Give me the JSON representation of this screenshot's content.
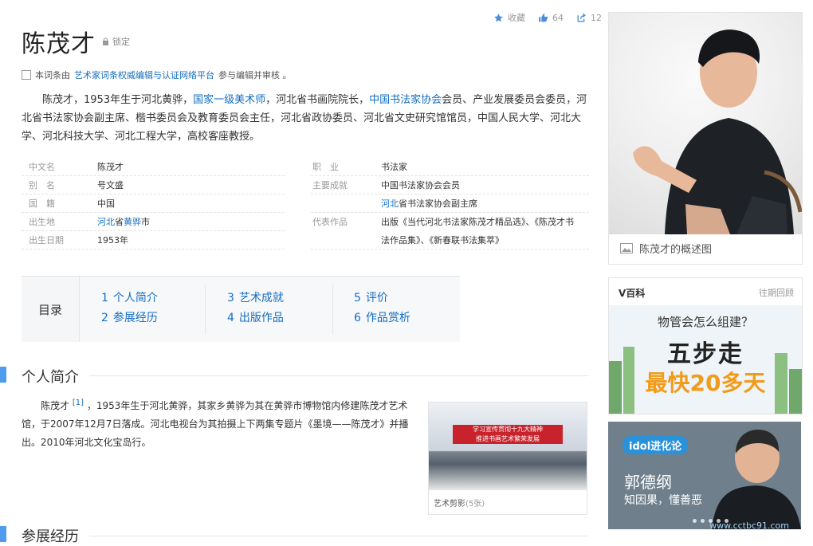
{
  "header": {
    "title": "陈茂才",
    "lock_label": "锁定",
    "favorite_label": "收藏",
    "like_count": "64",
    "share_count": "12"
  },
  "authority": {
    "prefix": "本词条由",
    "org": "艺术家词条权威编辑与认证网络平台",
    "suffix": "参与编辑并审核 。"
  },
  "summary": [
    {
      "t": "陈茂才，1953年生于河北黄骅，",
      "link": false
    },
    {
      "t": "国家一级美术师",
      "link": true
    },
    {
      "t": "，河北省书画院院长，",
      "link": false
    },
    {
      "t": "中国书法家协会",
      "link": true
    },
    {
      "t": "会员、产业发展委员会委员，河北省书法家协会副主席、楷书委员会及教育委员会主任，河北省政协委员、河北省文史研究馆馆员，中国人民大学、河北大学、河北科技大学、河北工程大学，高校客座教授。",
      "link": false
    }
  ],
  "infobox": {
    "left": [
      {
        "k": "中文名",
        "v": "陈茂才"
      },
      {
        "k": "别　名",
        "v": "号文盛"
      },
      {
        "k": "国　籍",
        "v": "中国"
      },
      {
        "k": "出生地",
        "v_link1": "河北",
        "v_mid": "省",
        "v_link2": "黄骅",
        "v_end": "市"
      },
      {
        "k": "出生日期",
        "v": "1953年"
      }
    ],
    "right": [
      {
        "k": "职　业",
        "v": "书法家"
      },
      {
        "k": "主要成就",
        "v": "中国书法家协会会员"
      },
      {
        "k": "",
        "v_link": "河北",
        "v_rest": "省书法家协会副主席"
      },
      {
        "k": "代表作品",
        "v": "出版《当代河北书法家陈茂才精品选》、《陈茂才书"
      },
      {
        "k": "",
        "v": "法作品集》、《新春联书法集萃》"
      }
    ]
  },
  "catalog": {
    "title": "目录",
    "items": [
      {
        "n": "1",
        "label": "个人简介"
      },
      {
        "n": "2",
        "label": "参展经历"
      },
      {
        "n": "3",
        "label": "艺术成就"
      },
      {
        "n": "4",
        "label": "出版作品"
      },
      {
        "n": "5",
        "label": "评价"
      },
      {
        "n": "6",
        "label": "作品赏析"
      }
    ]
  },
  "section1": {
    "title": "个人简介",
    "name": "陈茂才",
    "ref": "[1]",
    "text": "，1953年生于河北黄骅，其家乡黄骅为其在黄骅市博物馆内修建陈茂才艺术馆，于2007年12月7日落成。河北电视台为其拍摄上下两集专题片《墨境——陈茂才》并播出。2010年河北文化宝岛行。"
  },
  "photo": {
    "caption": "艺术剪影",
    "count": "(5张)",
    "banner_line1": "学习宣传贯彻十九大精神",
    "banner_line2": "推进书画艺术繁荣发展"
  },
  "section2": {
    "title": "参展经历"
  },
  "portrait": {
    "caption": "陈茂才的概述图"
  },
  "vbaike": {
    "title": "V百科",
    "more": "往期回顾",
    "ad_question": "物管会怎么组建？",
    "ad_big": "五步走",
    "ad_sub": "最快20多天"
  },
  "ad2": {
    "logo": "idol进化论",
    "name": "郭德纲",
    "slogan": "知因果，懂善恶"
  },
  "watermark": "www.cctbc91.com",
  "colors": {
    "link": "#136ec2",
    "accent_bar": "#4f9cee",
    "ad_orange": "#f29b1a"
  }
}
